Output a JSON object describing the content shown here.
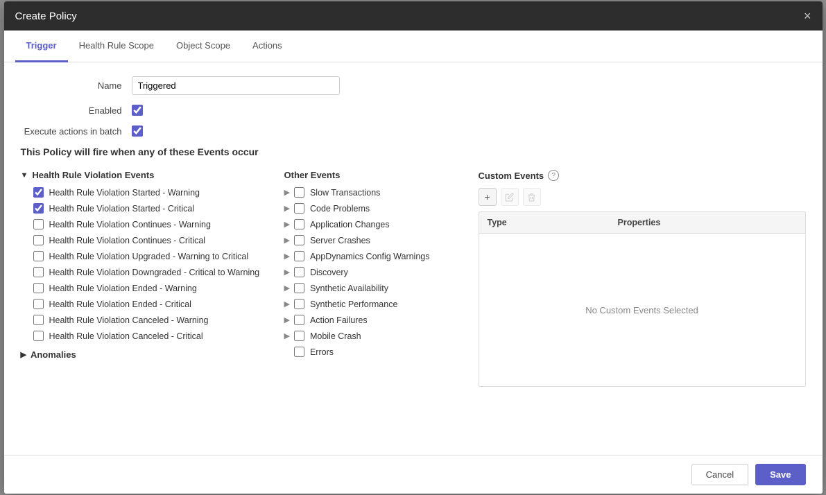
{
  "modal": {
    "title": "Create Policy",
    "close_label": "×"
  },
  "tabs": [
    {
      "id": "trigger",
      "label": "Trigger",
      "active": true
    },
    {
      "id": "health-rule-scope",
      "label": "Health Rule Scope",
      "active": false
    },
    {
      "id": "object-scope",
      "label": "Object Scope",
      "active": false
    },
    {
      "id": "actions",
      "label": "Actions",
      "active": false
    }
  ],
  "form": {
    "name_label": "Name",
    "name_value": "Triggered",
    "enabled_label": "Enabled",
    "execute_batch_label": "Execute actions in batch"
  },
  "policy_header": "This Policy will fire when any of these Events occur",
  "health_rule_section": {
    "label": "Health Rule Violation Events",
    "expanded": true,
    "items": [
      {
        "id": "hrv1",
        "label": "Health Rule Violation Started - Warning",
        "checked": true
      },
      {
        "id": "hrv2",
        "label": "Health Rule Violation Started - Critical",
        "checked": true
      },
      {
        "id": "hrv3",
        "label": "Health Rule Violation Continues - Warning",
        "checked": false
      },
      {
        "id": "hrv4",
        "label": "Health Rule Violation Continues - Critical",
        "checked": false
      },
      {
        "id": "hrv5",
        "label": "Health Rule Violation Upgraded - Warning to Critical",
        "checked": false
      },
      {
        "id": "hrv6",
        "label": "Health Rule Violation Downgraded - Critical to Warning",
        "checked": false
      },
      {
        "id": "hrv7",
        "label": "Health Rule Violation Ended - Warning",
        "checked": false
      },
      {
        "id": "hrv8",
        "label": "Health Rule Violation Ended - Critical",
        "checked": false
      },
      {
        "id": "hrv9",
        "label": "Health Rule Violation Canceled - Warning",
        "checked": false
      },
      {
        "id": "hrv10",
        "label": "Health Rule Violation Canceled - Critical",
        "checked": false
      }
    ]
  },
  "anomalies_section": {
    "label": "Anomalies",
    "expanded": false
  },
  "other_events_section": {
    "label": "Other Events",
    "items": [
      {
        "id": "oe1",
        "label": "Slow Transactions",
        "checked": false
      },
      {
        "id": "oe2",
        "label": "Code Problems",
        "checked": false
      },
      {
        "id": "oe3",
        "label": "Application Changes",
        "checked": false
      },
      {
        "id": "oe4",
        "label": "Server Crashes",
        "checked": false
      },
      {
        "id": "oe5",
        "label": "AppDynamics Config Warnings",
        "checked": false
      },
      {
        "id": "oe6",
        "label": "Discovery",
        "checked": false
      },
      {
        "id": "oe7",
        "label": "Synthetic Availability",
        "checked": false
      },
      {
        "id": "oe8",
        "label": "Synthetic Performance",
        "checked": false
      },
      {
        "id": "oe9",
        "label": "Action Failures",
        "checked": false
      },
      {
        "id": "oe10",
        "label": "Mobile Crash",
        "checked": false
      },
      {
        "id": "oe11",
        "label": "Errors",
        "checked": false
      }
    ]
  },
  "custom_events_section": {
    "label": "Custom Events",
    "toolbar": {
      "add_label": "+",
      "edit_label": "✎",
      "delete_label": "🗑"
    },
    "table": {
      "headers": [
        "Type",
        "Properties"
      ],
      "no_data_text": "No Custom Events Selected"
    }
  },
  "footer": {
    "cancel_label": "Cancel",
    "save_label": "Save"
  }
}
